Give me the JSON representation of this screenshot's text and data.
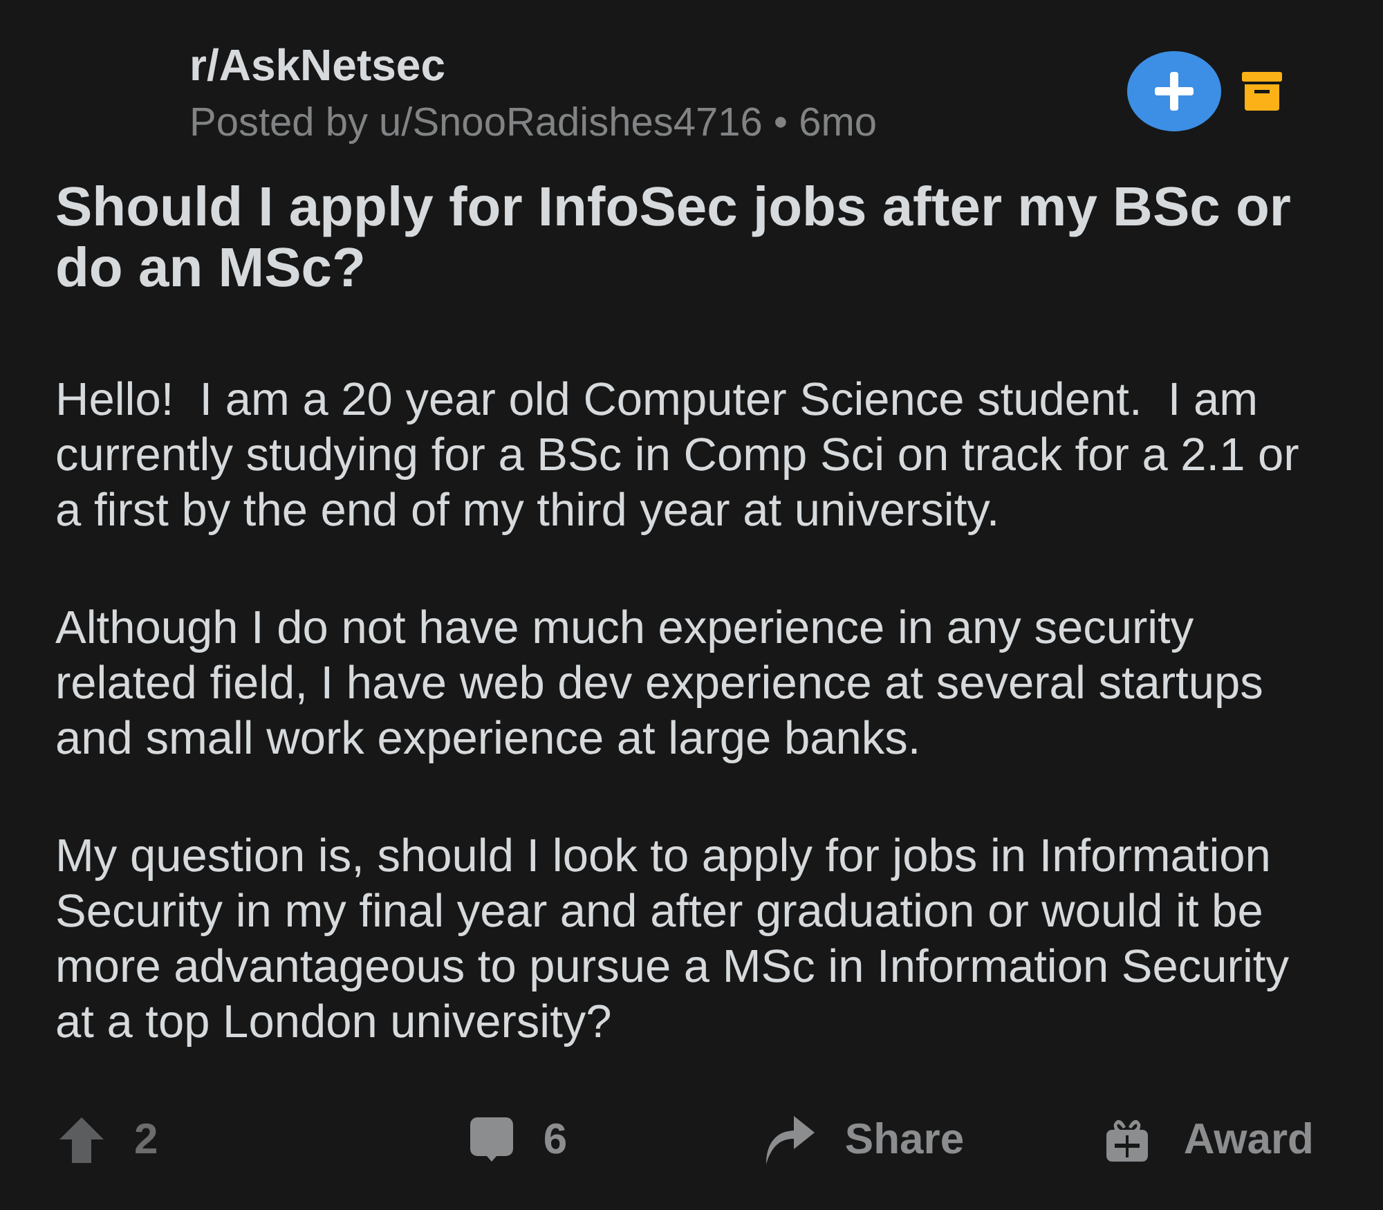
{
  "post": {
    "subreddit": "r/AskNetsec",
    "meta": "Posted by u/SnooRadishes4716 • 6mo",
    "title": "Should I apply for InfoSec jobs after my BSc or do an MSc?",
    "paragraphs": [
      "Hello!  I am a 20 year old Computer Science student.  I am currently studying for a BSc in Comp Sci on track for a 2.1 or a first by the end of my third year at university.",
      "Although I do not have much experience in any security related field, I have web dev experience at several startups and small work experience at large banks.",
      "My question is, should I look to apply for jobs in Information Security in my final year and after graduation or would it be more advantageous to pursue a MSc in Information Security at a top London university?"
    ]
  },
  "actions": [
    {
      "kind": "upvote",
      "label": "2"
    },
    {
      "kind": "comment",
      "label": "6"
    },
    {
      "kind": "share",
      "label": "Share"
    },
    {
      "kind": "award",
      "label": "Award"
    }
  ]
}
